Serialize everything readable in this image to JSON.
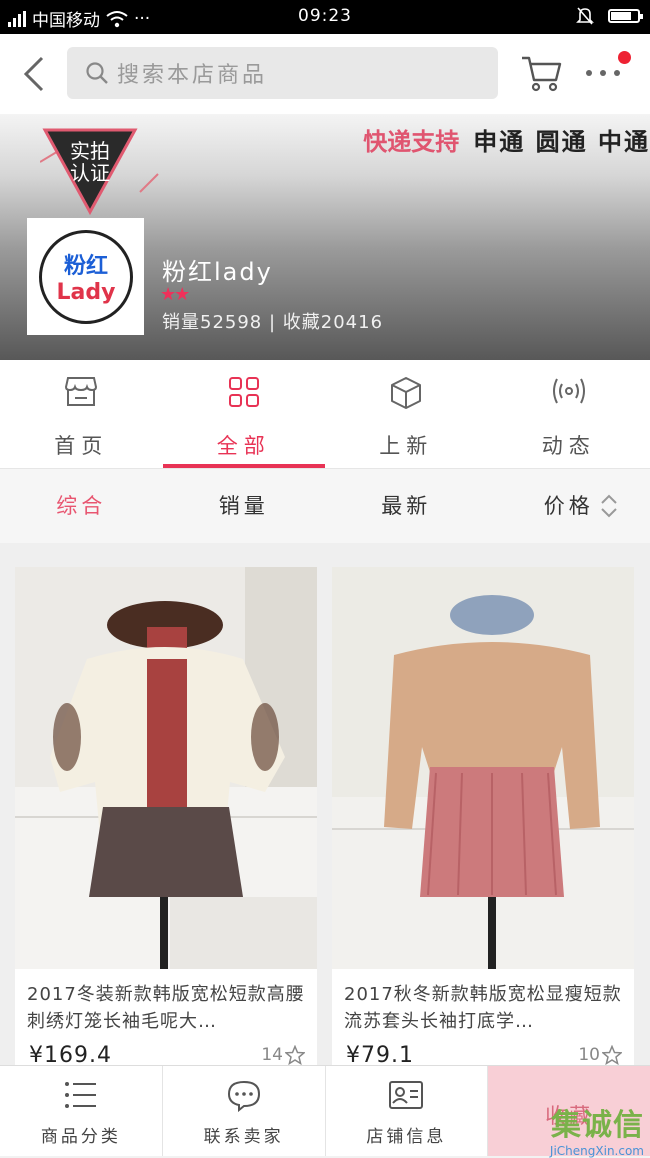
{
  "status_bar": {
    "carrier": "中国移动",
    "dots": "···",
    "time": "09:23"
  },
  "header": {
    "search_placeholder": "搜索本店商品"
  },
  "banner": {
    "badge_text_1": "实拍",
    "badge_text_2": "认证",
    "express_label": "快递支持",
    "express_carriers": "申通 圆通 中通",
    "logo_text_1": "粉红",
    "logo_text_2": "Lady",
    "shop_name": "粉红lady",
    "stars": "★★",
    "stats": "销量52598 | 收藏20416"
  },
  "tabs": [
    {
      "label": "首页",
      "icon": "store-icon"
    },
    {
      "label": "全部",
      "icon": "grid-icon",
      "active": true
    },
    {
      "label": "上新",
      "icon": "box-icon"
    },
    {
      "label": "动态",
      "icon": "broadcast-icon"
    }
  ],
  "sort": [
    {
      "label": "综合",
      "active": true
    },
    {
      "label": "销量"
    },
    {
      "label": "最新"
    },
    {
      "label": "价格"
    }
  ],
  "products": [
    {
      "title": "2017冬装新款韩版宽松短款高腰刺绣灯笼长袖毛呢大…",
      "price": "¥169.4",
      "fav_count": "14"
    },
    {
      "title": "2017秋冬新款韩版宽松显瘦短款流苏套头长袖打底学…",
      "price": "¥79.1",
      "fav_count": "10"
    }
  ],
  "bottom_bar": [
    {
      "label": "商品分类",
      "icon": "list-icon"
    },
    {
      "label": "联系卖家",
      "icon": "chat-icon"
    },
    {
      "label": "店铺信息",
      "icon": "id-card-icon"
    },
    {
      "label": "收藏"
    }
  ],
  "watermark": {
    "brand": "集诚信",
    "url": "JiChengXin.com"
  },
  "colors": {
    "accent": "#e83355",
    "favorite_bg": "#f8cfd6"
  }
}
